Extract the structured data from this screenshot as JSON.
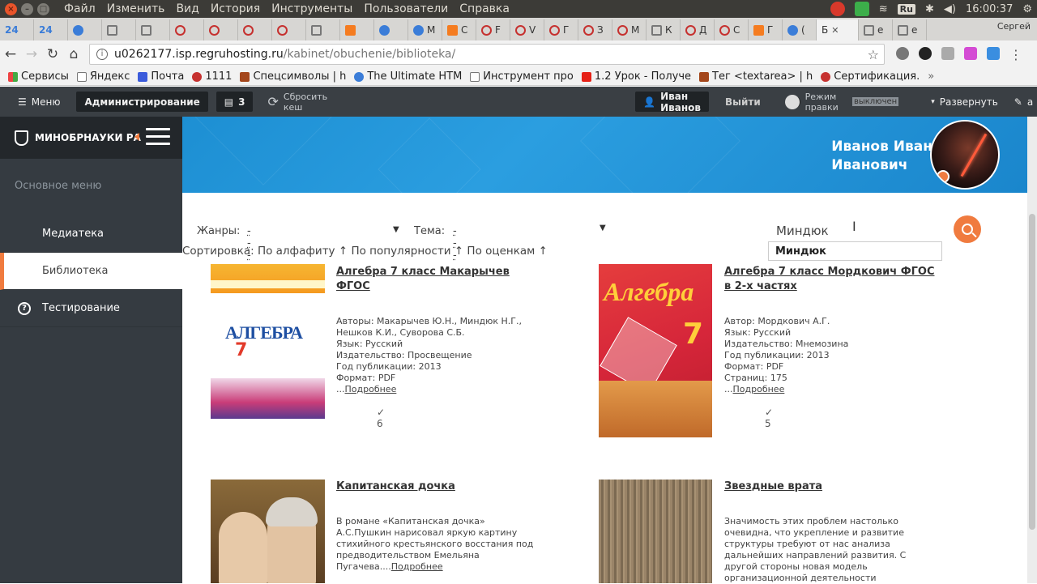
{
  "os": {
    "menu": [
      "Файл",
      "Изменить",
      "Вид",
      "История",
      "Инструменты",
      "Пользователи",
      "Справка"
    ],
    "lang": "Ru",
    "time": "16:00:37"
  },
  "tabs": {
    "items": [
      "24",
      "24",
      "",
      "",
      "",
      "",
      "",
      "",
      "",
      "",
      "",
      "",
      "М",
      "С",
      "F",
      "V",
      "Г",
      "З",
      "М",
      "К",
      "Д",
      "С",
      "Г",
      "(",
      "Б",
      "е",
      "е"
    ],
    "active_label": "Б",
    "user": "Сергей"
  },
  "address": {
    "url_host": "u0262177.isp.regruhosting.ru",
    "url_path": "/kabinet/obuchenie/biblioteka/"
  },
  "bookmarks": [
    {
      "label": "Сервисы",
      "icon": "grid"
    },
    {
      "label": "Яндекс",
      "icon": "doc"
    },
    {
      "label": "Почта",
      "icon": "mail"
    },
    {
      "label": "1111",
      "icon": "red"
    },
    {
      "label": "Спецсимволы | h",
      "icon": "brown"
    },
    {
      "label": "The Ultimate HTM",
      "icon": "blue"
    },
    {
      "label": "Инструмент про",
      "icon": "doc"
    },
    {
      "label": "1.2 Урок - Получе",
      "icon": "yt"
    },
    {
      "label": "Тег <textarea> | h",
      "icon": "brown"
    },
    {
      "label": "Сертификация.",
      "icon": "red"
    }
  ],
  "admin": {
    "menu": "Меню",
    "administration": "Администрирование",
    "count": "3",
    "reset_cache": "Сбросить кеш",
    "user": "Иван Иванов",
    "logout": "Выйти",
    "edit_mode_label": "Режим правки",
    "edit_mode_value": "выключен",
    "expand": "Развернуть",
    "pin": "а"
  },
  "sidebar": {
    "brand": "МИНОБРНАУКИ РА",
    "section": "Основное меню",
    "items": [
      "Медиатека",
      "Библиотека",
      "Тестирование"
    ]
  },
  "profile": {
    "name_line1": "Иванов Иван",
    "name_line2": "Иванович"
  },
  "filters": {
    "genres_label": "Жанры:",
    "genres_value": "---",
    "theme_label": "Тема:",
    "theme_value": "---",
    "search_value": "Миндюк",
    "suggestion": "Миндюк"
  },
  "sort": {
    "label": "Сортировка:",
    "options": [
      "По алфафиту ↑",
      "По популярности ↑",
      "По оценкам ↑"
    ]
  },
  "books": [
    {
      "title": "Алгебра 7 класс Макарычев ФГОС",
      "meta": [
        "Авторы: Макарычев Ю.Н., Миндюк Н.Г., Нешков К.И., Суворова С.Б.",
        "Язык: Русский",
        "Издательство: Просвещение",
        "Год публикации: 2013",
        "Формат: PDF"
      ],
      "more": "Подробнее",
      "votes": "6",
      "cover": {
        "word": "АЛГЕБРА",
        "num": "7"
      }
    },
    {
      "title": "Алгебра 7 класс Мордкович ФГОС в 2-х частях",
      "meta": [
        "Автор: Мордкович А.Г.",
        "Язык: Русский",
        "Издательство: Мнемозина",
        "Год публикации: 2013",
        "Формат: PDF",
        "Страниц: 175"
      ],
      "more": "Подробнее",
      "votes": "5",
      "cover": {
        "word": "Алгебра",
        "num": "7"
      }
    },
    {
      "title": "Капитанская дочка",
      "desc": "В романе «Капитанская дочка» А.С.Пушкин нарисовал яркую картину стихийного крестьянского восстания под предводительством Емельяна Пугачева....",
      "more": "Подробнее"
    },
    {
      "title": "Звездные врата",
      "desc": "Значимость этих проблем настолько очевидна, что укрепление и развитие структуры требуют от нас анализа дальнейших направлений развития. С другой стороны новая модель организационной деятельности"
    }
  ]
}
